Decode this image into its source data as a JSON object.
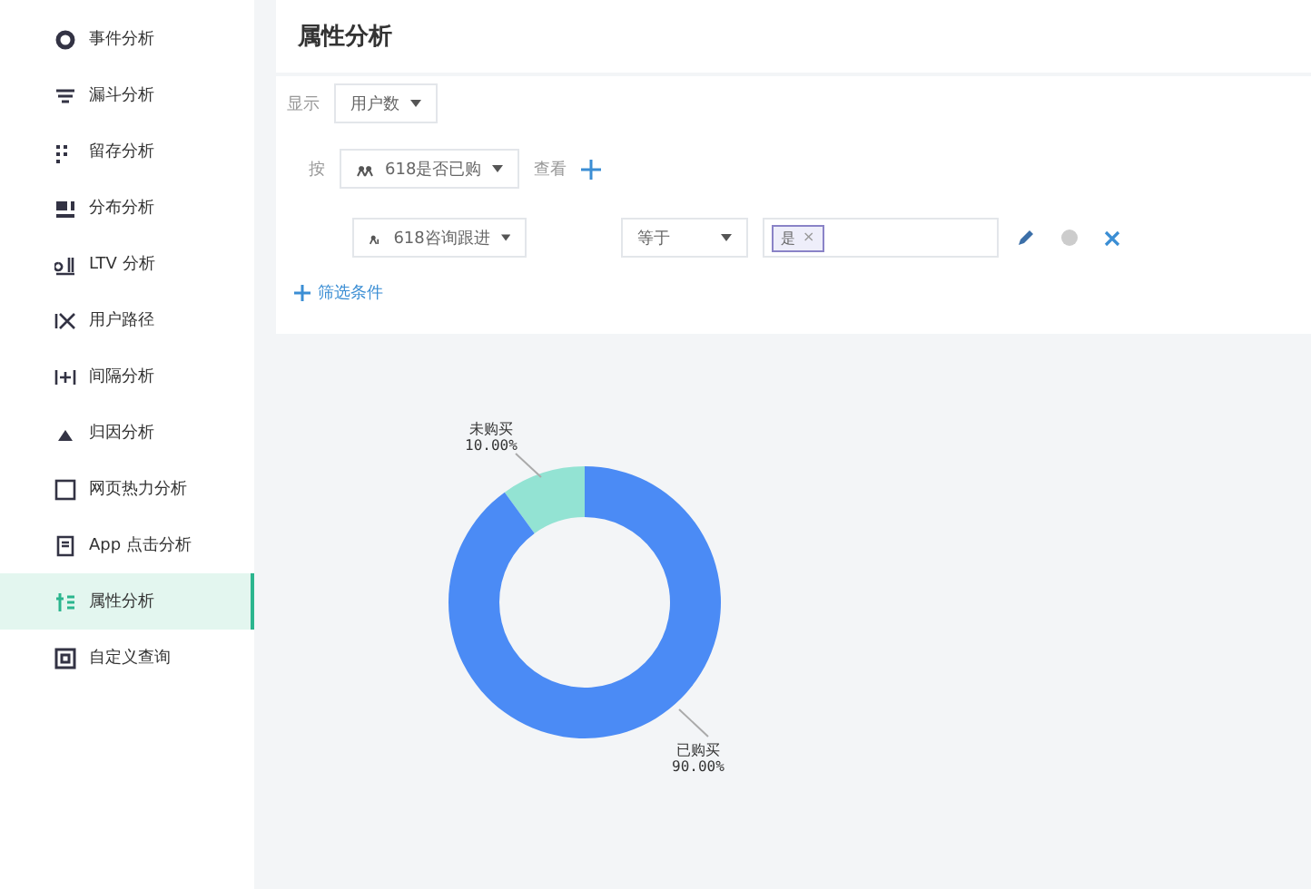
{
  "sidebar": {
    "items": [
      {
        "label": "事件分析",
        "selected": false
      },
      {
        "label": "漏斗分析",
        "selected": false
      },
      {
        "label": "留存分析",
        "selected": false
      },
      {
        "label": "分布分析",
        "selected": false
      },
      {
        "label": "LTV 分析",
        "selected": false
      },
      {
        "label": "用户路径",
        "selected": false
      },
      {
        "label": "间隔分析",
        "selected": false
      },
      {
        "label": "归因分析",
        "selected": false
      },
      {
        "label": "网页热力分析",
        "selected": false
      },
      {
        "label": "App 点击分析",
        "selected": false
      },
      {
        "label": "属性分析",
        "selected": true
      },
      {
        "label": "自定义查询",
        "selected": false
      }
    ]
  },
  "page_title": "属性分析",
  "display": {
    "label": "显示",
    "value": "用户数"
  },
  "group_by": {
    "label": "按",
    "value": "618是否已购",
    "suffix": "查看"
  },
  "filter": {
    "property": "618咨询跟进",
    "operator": "等于",
    "tags": [
      {
        "text": "是",
        "remove": "×"
      }
    ]
  },
  "add_filter": "筛选条件",
  "chart": {
    "chart_data": {
      "type": "donut",
      "categories": [
        "未购买",
        "已购买"
      ],
      "values": [
        10,
        90
      ],
      "value_labels": [
        "10.00%",
        "90.00%"
      ]
    }
  }
}
